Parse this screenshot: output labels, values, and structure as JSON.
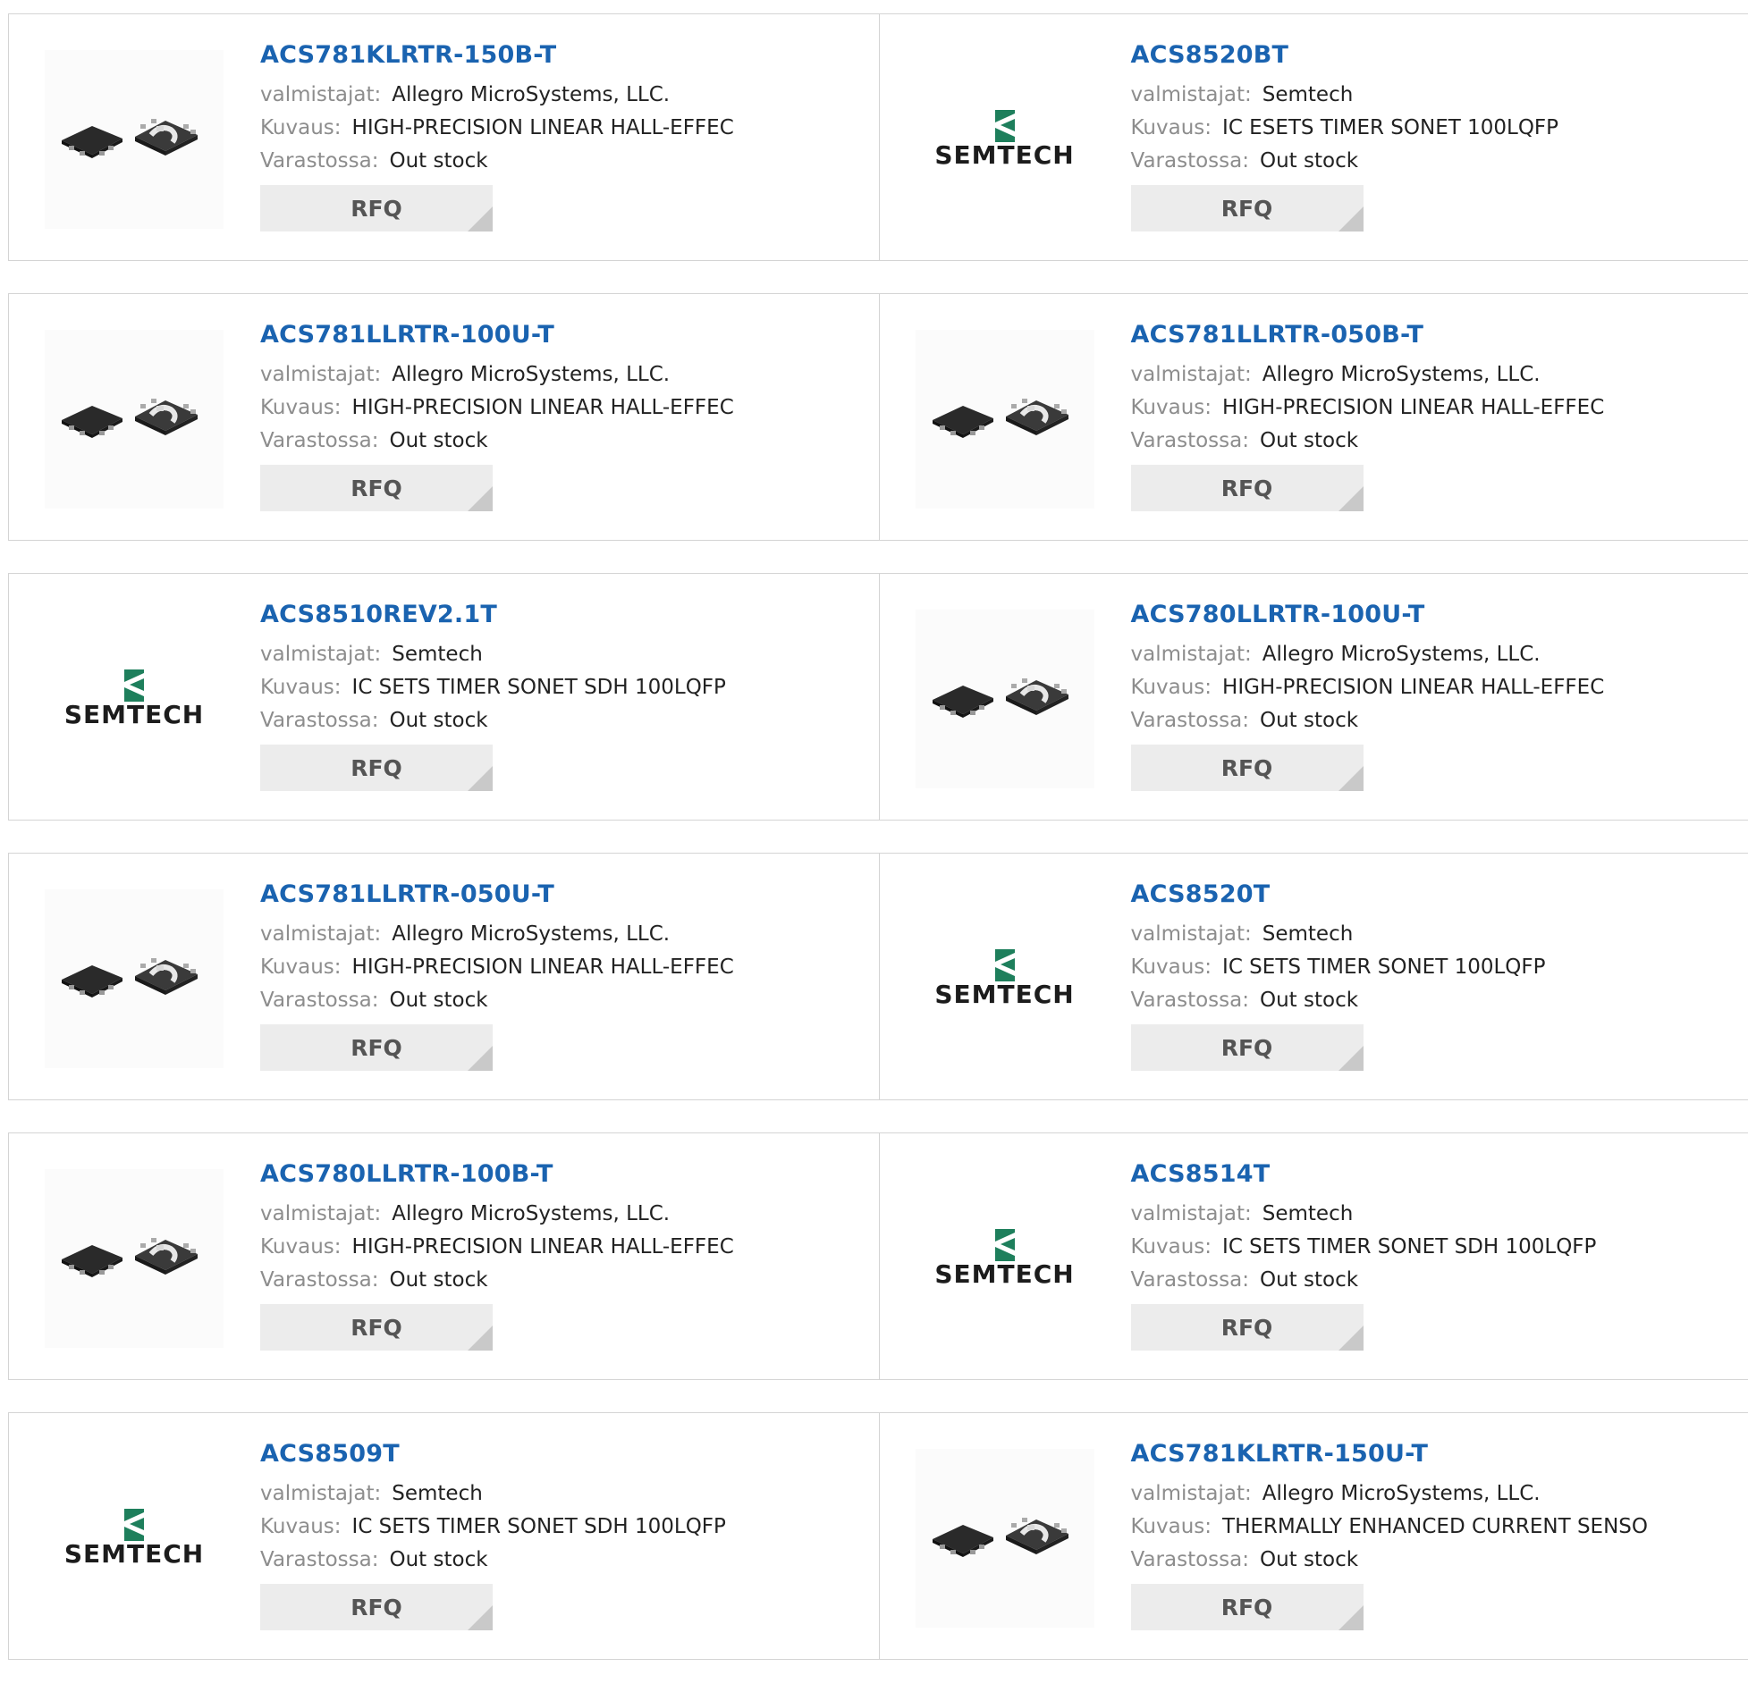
{
  "labels": {
    "manufacturer": "valmistajat:",
    "description": "Kuvaus:",
    "stock": "Varastossa:",
    "rfq": "RFQ"
  },
  "brand_colors": {
    "link": "#1a63b0",
    "semtech_green": "#1e7f5c"
  },
  "products": [
    {
      "name": "ACS781KLRTR-150B-T",
      "manufacturer": "Allegro MicroSystems, LLC.",
      "description": "HIGH-PRECISION LINEAR HALL-EFFEC",
      "stock": "Out stock",
      "image": "chip-icon"
    },
    {
      "name": "ACS8520BT",
      "manufacturer": "Semtech",
      "description": "IC ESETS TIMER SONET 100LQFP",
      "stock": "Out stock",
      "image": "semtech-logo",
      "logo_text": "SEMTECH"
    },
    {
      "name": "ACS781LLRTR-100U-T",
      "manufacturer": "Allegro MicroSystems, LLC.",
      "description": "HIGH-PRECISION LINEAR HALL-EFFEC",
      "stock": "Out stock",
      "image": "chip-icon"
    },
    {
      "name": "ACS781LLRTR-050B-T",
      "manufacturer": "Allegro MicroSystems, LLC.",
      "description": "HIGH-PRECISION LINEAR HALL-EFFEC",
      "stock": "Out stock",
      "image": "chip-icon"
    },
    {
      "name": "ACS8510REV2.1T",
      "manufacturer": "Semtech",
      "description": "IC SETS TIMER SONET SDH 100LQFP",
      "stock": "Out stock",
      "image": "semtech-logo",
      "logo_text": "SEMTECH"
    },
    {
      "name": "ACS780LLRTR-100U-T",
      "manufacturer": "Allegro MicroSystems, LLC.",
      "description": "HIGH-PRECISION LINEAR HALL-EFFEC",
      "stock": "Out stock",
      "image": "chip-icon"
    },
    {
      "name": "ACS781LLRTR-050U-T",
      "manufacturer": "Allegro MicroSystems, LLC.",
      "description": "HIGH-PRECISION LINEAR HALL-EFFEC",
      "stock": "Out stock",
      "image": "chip-icon"
    },
    {
      "name": "ACS8520T",
      "manufacturer": "Semtech",
      "description": "IC SETS TIMER SONET 100LQFP",
      "stock": "Out stock",
      "image": "semtech-logo",
      "logo_text": "SEMTECH"
    },
    {
      "name": "ACS780LLRTR-100B-T",
      "manufacturer": "Allegro MicroSystems, LLC.",
      "description": "HIGH-PRECISION LINEAR HALL-EFFEC",
      "stock": "Out stock",
      "image": "chip-icon"
    },
    {
      "name": "ACS8514T",
      "manufacturer": "Semtech",
      "description": "IC SETS TIMER SONET SDH 100LQFP",
      "stock": "Out stock",
      "image": "semtech-logo",
      "logo_text": "SEMTECH"
    },
    {
      "name": "ACS8509T",
      "manufacturer": "Semtech",
      "description": "IC SETS TIMER SONET SDH 100LQFP",
      "stock": "Out stock",
      "image": "semtech-logo",
      "logo_text": "SEMTECH"
    },
    {
      "name": "ACS781KLRTR-150U-T",
      "manufacturer": "Allegro MicroSystems, LLC.",
      "description": "THERMALLY ENHANCED CURRENT SENSO",
      "stock": "Out stock",
      "image": "chip-icon"
    }
  ]
}
